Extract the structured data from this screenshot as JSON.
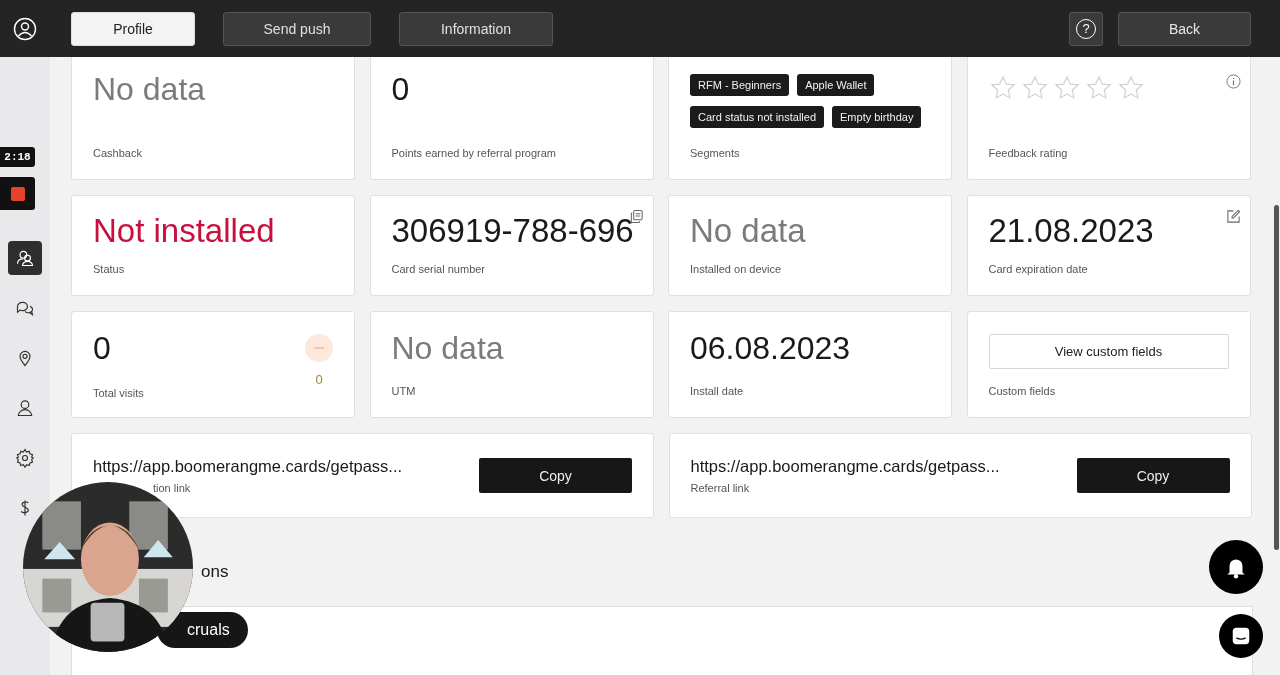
{
  "header": {
    "tabs": [
      {
        "label": "Profile",
        "selected": true
      },
      {
        "label": "Send push",
        "selected": false
      },
      {
        "label": "Information",
        "selected": false
      }
    ],
    "help_button": "?",
    "back_button": "Back"
  },
  "recording": {
    "timer": "2:18"
  },
  "sidebar": {
    "items": [
      {
        "kind": "clients",
        "selected": true
      },
      {
        "kind": "chat",
        "selected": false
      },
      {
        "kind": "pin",
        "selected": false
      },
      {
        "kind": "person",
        "selected": false
      },
      {
        "kind": "gear",
        "selected": false
      },
      {
        "kind": "dollar",
        "selected": false
      }
    ]
  },
  "rows": [
    [
      {
        "kind": "value",
        "value": "No data",
        "muted": true,
        "alert": false,
        "label": "Cashback"
      },
      {
        "kind": "value",
        "value": "0",
        "muted": false,
        "alert": false,
        "label": "Points earned by referral program"
      },
      {
        "kind": "tags",
        "tags": [
          "RFM - Beginners",
          "Apple Wallet",
          "Card status not installed",
          "Empty birthday"
        ],
        "label": "Segments"
      },
      {
        "kind": "rating",
        "stars": 0,
        "corner": {
          "kind": "info"
        },
        "label": "Feedback rating"
      }
    ],
    [
      {
        "kind": "value",
        "value": "Not installed",
        "muted": false,
        "alert": true,
        "label": "Status"
      },
      {
        "kind": "value",
        "value": "306919-788-696",
        "muted": false,
        "alert": false,
        "corner": {
          "kind": "copy"
        },
        "label": "Card serial number"
      },
      {
        "kind": "value",
        "value": "No data",
        "muted": true,
        "alert": false,
        "label": "Installed on device"
      },
      {
        "kind": "value",
        "value": "21.08.2023",
        "muted": false,
        "alert": false,
        "corner": {
          "kind": "edit"
        },
        "label": "Card expiration date"
      }
    ],
    [
      {
        "kind": "value",
        "value": "0",
        "muted": false,
        "alert": false,
        "change": "0",
        "label": "Total visits"
      },
      {
        "kind": "value",
        "value": "No data",
        "muted": true,
        "alert": false,
        "label": "UTM"
      },
      {
        "kind": "value",
        "value": "06.08.2023",
        "muted": false,
        "alert": false,
        "label": "Install date"
      },
      {
        "kind": "button",
        "button": "View custom fields",
        "label": "Custom fields"
      }
    ]
  ],
  "links": [
    {
      "url": "https://app.boomerangme.cards/getpass...",
      "label": "tion link",
      "button": "Copy"
    },
    {
      "url": "https://app.boomerangme.cards/getpass...",
      "label": "Referral link",
      "button": "Copy"
    }
  ],
  "section": {
    "title": "ons",
    "button": "cruals"
  }
}
